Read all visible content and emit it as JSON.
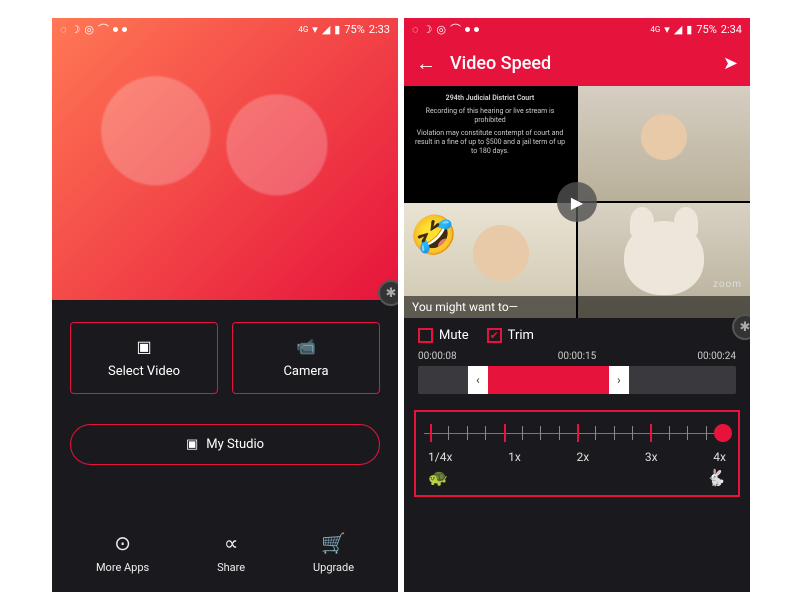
{
  "status": {
    "network_label": "4G",
    "battery_pct": "75%",
    "time_left": "2:33",
    "time_right": "2:34"
  },
  "left": {
    "select_video": "Select Video",
    "camera": "Camera",
    "my_studio": "My Studio",
    "nav": {
      "more": "More Apps",
      "share": "Share",
      "upgrade": "Upgrade"
    }
  },
  "right": {
    "title": "Video Speed",
    "caption": "You might want to—",
    "watermark": "zoom",
    "court_header": "294th Judicial District Court",
    "court_line1": "Recording of this hearing or live stream is prohibited",
    "court_line2": "Violation may constitute contempt of court and result in a fine of up to $500 and a jail term of up to 180 days.",
    "mute": "Mute",
    "trim": "Trim",
    "times": {
      "start": "00:00:08",
      "mid": "00:00:15",
      "end": "00:00:24"
    },
    "speeds": [
      "1/4x",
      "1x",
      "2x",
      "3x",
      "4x"
    ]
  }
}
